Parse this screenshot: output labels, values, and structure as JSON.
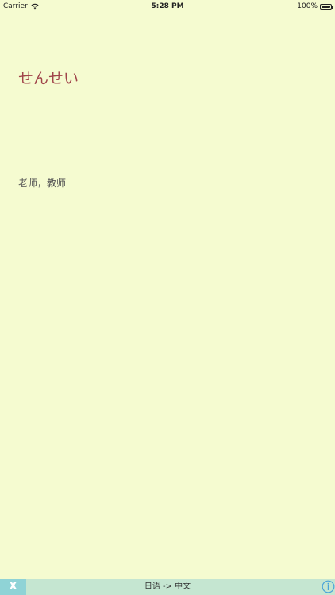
{
  "status_bar": {
    "carrier": "Carrier",
    "time": "5:28 PM",
    "battery": "100%"
  },
  "card": {
    "word": "せんせい",
    "meaning": "老师，教师"
  },
  "bottom_bar": {
    "close_label": "X",
    "mode_label": "日语 -> 中文"
  },
  "colors": {
    "background": "#f5fbd0",
    "word": "#a0444a",
    "bottom_bar": "#c5e6d1",
    "close_button": "#8fd3d6",
    "info_icon": "#4aa3d8"
  },
  "icons": {
    "wifi": "wifi-icon",
    "battery": "battery-icon",
    "info": "info-icon"
  }
}
